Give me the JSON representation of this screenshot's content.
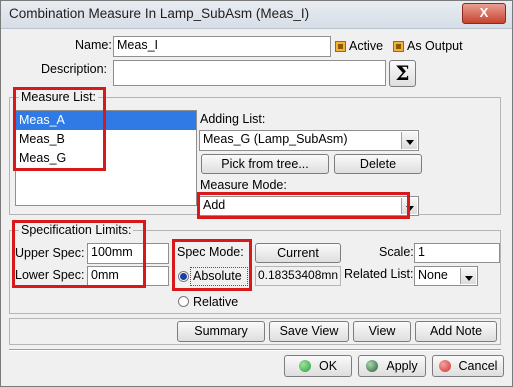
{
  "window": {
    "title": "Combination Measure In Lamp_SubAsm (Meas_I)",
    "close_label": "X"
  },
  "name": {
    "label": "Name:",
    "value": "Meas_I"
  },
  "active": {
    "label": "Active"
  },
  "as_output": {
    "label": "As Output"
  },
  "description": {
    "label": "Description:",
    "value": "",
    "formula_icon": "Σ"
  },
  "measure_list": {
    "label": "Measure List:",
    "items": [
      "Meas_A",
      "Meas_B",
      "Meas_G"
    ],
    "selected_index": 0
  },
  "adding_list": {
    "label": "Adding List:",
    "value": "Meas_G (Lamp_SubAsm)"
  },
  "pick_button": "Pick from tree...",
  "delete_button": "Delete",
  "measure_mode": {
    "label": "Measure Mode:",
    "value": "Add"
  },
  "spec_limits": {
    "label": "Specification Limits:",
    "upper_label": "Upper Spec:",
    "upper_value": "100mm",
    "lower_label": "Lower Spec:",
    "lower_value": "0mm"
  },
  "spec_mode": {
    "label": "Spec Mode:",
    "absolute": "Absolute",
    "relative": "Relative",
    "selected": "Absolute"
  },
  "current_button": "Current",
  "current_value": "0.18353408mn",
  "scale": {
    "label": "Scale:",
    "value": "1"
  },
  "related_list": {
    "label": "Related List:",
    "value": "None"
  },
  "actions": {
    "summary": "Summary",
    "save_view": "Save View",
    "view": "View",
    "add_note": "Add Note"
  },
  "footer": {
    "ok": "OK",
    "apply": "Apply",
    "cancel": "Cancel"
  },
  "colors": {
    "highlight_box": "#d7191c",
    "selection": "#2f7ae5",
    "ok_icon": "#2e9e3a",
    "apply_icon": "#2a8a3a",
    "cancel_icon": "#d2322d"
  }
}
